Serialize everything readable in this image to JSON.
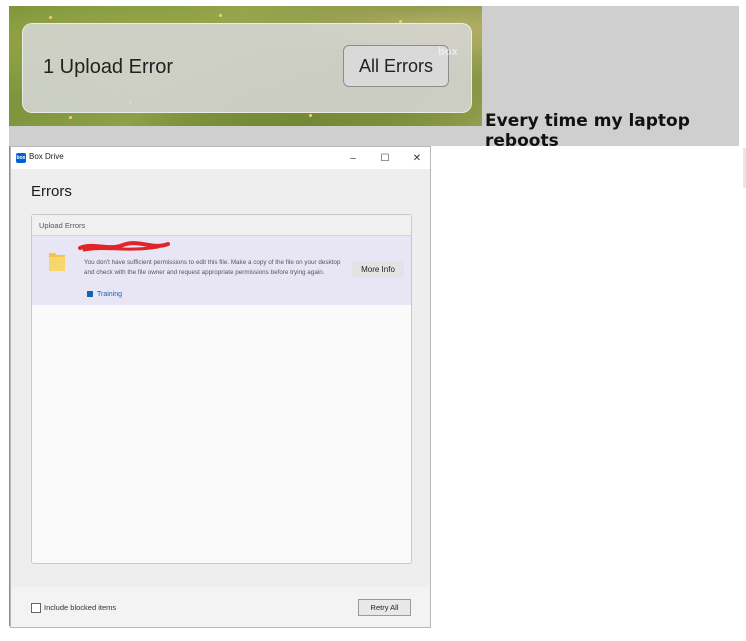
{
  "toast": {
    "title": "1 Upload Error",
    "button_label": "All Errors",
    "watermark": "box"
  },
  "caption": "Every time my laptop reboots",
  "window": {
    "title": "Box Drive",
    "app_icon_text": "box",
    "controls": {
      "minimize": "–",
      "maximize": "☐",
      "close": "✕"
    },
    "heading": "Errors",
    "panel_header": "Upload Errors",
    "errors": [
      {
        "message": "You don't have sufficient permissions to edit this file. Make a copy of the file on your desktop and check with the file owner and request appropriate permissions before trying again.",
        "folder": "Training",
        "more_info_label": "More Info"
      }
    ],
    "footer": {
      "checkbox_label": "Include blocked items",
      "checkbox_checked": false,
      "retry_label": "Retry All"
    }
  },
  "colors": {
    "accent": "#1a5fb4",
    "error_row": "#e8e6f4",
    "redaction": "#e0242a"
  }
}
